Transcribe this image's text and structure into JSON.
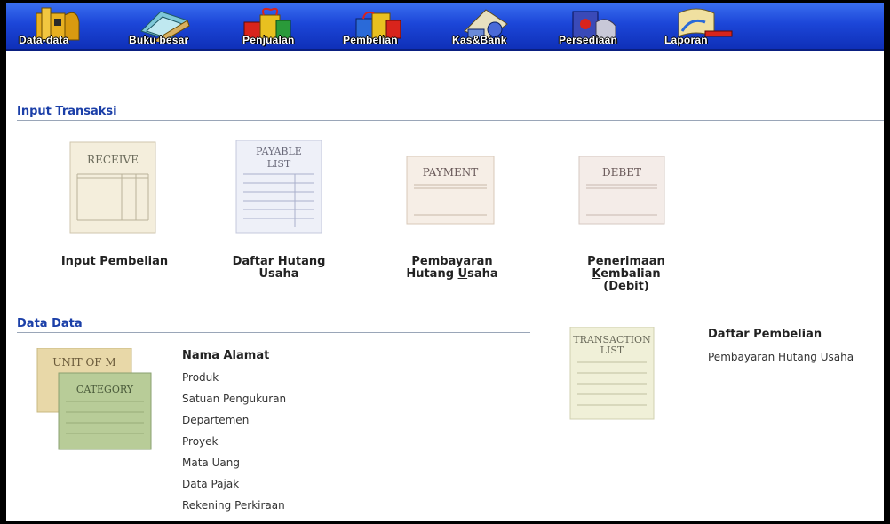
{
  "toolbar": {
    "items": [
      {
        "label": "Data-data",
        "icon": "building-icon"
      },
      {
        "label": "Buku besar",
        "icon": "ledger-book-icon"
      },
      {
        "label": "Penjualan",
        "icon": "gift-boxes-icon"
      },
      {
        "label": "Pembelian",
        "icon": "shopping-gifts-icon"
      },
      {
        "label": "Kas&Bank",
        "icon": "cash-bank-icon"
      },
      {
        "label": "Persediaan",
        "icon": "inventory-icon"
      },
      {
        "label": "Laporan",
        "icon": "report-scroll-icon"
      }
    ]
  },
  "input_transaksi": {
    "title": "Input Transaksi",
    "items": [
      {
        "doc_text": "RECEIVE",
        "label_lines": [
          "Input Pembelian"
        ],
        "hotkey": "",
        "icon": "receive-form-icon"
      },
      {
        "doc_text": "PAYABLE LIST",
        "label_lines": [
          "Daftar Hutang",
          "Usaha"
        ],
        "hotkey": "H",
        "icon": "payable-list-icon"
      },
      {
        "doc_text": "PAYMENT",
        "label_lines": [
          "Pembayaran",
          "Hutang Usaha"
        ],
        "hotkey": "U",
        "icon": "payment-form-icon"
      },
      {
        "doc_text": "DEBET",
        "label_lines": [
          "Penerimaan",
          "Kembalian",
          "(Debit)"
        ],
        "hotkey": "K",
        "icon": "debet-form-icon"
      }
    ]
  },
  "data_data": {
    "title": "Data Data",
    "doc_texts": {
      "back": "UNIT OF M",
      "front": "CATEGORY"
    },
    "links": [
      "Nama Alamat",
      "Produk",
      "Satuan Pengukuran",
      "Departemen",
      "Proyek",
      "Mata Uang",
      "Data Pajak",
      "Rekening Perkiraan"
    ]
  },
  "daftar": {
    "doc_text": "TRANSACTION LIST",
    "links": [
      "Daftar Pembelian",
      "Pembayaran Hutang Usaha"
    ]
  }
}
